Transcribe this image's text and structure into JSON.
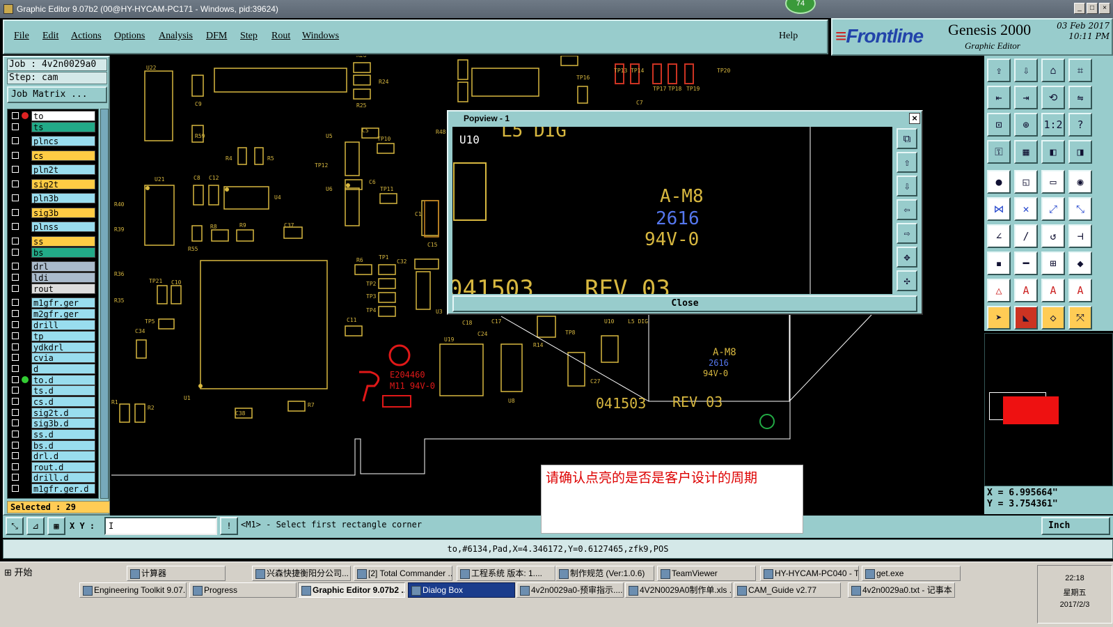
{
  "window": {
    "title": "Graphic Editor 9.07b2 (00@HY-HYCAM-PC171 - Windows, pid:39624)",
    "badge": "74"
  },
  "menu": [
    "File",
    "Edit",
    "Actions",
    "Options",
    "Analysis",
    "DFM",
    "Step",
    "Rout",
    "Windows"
  ],
  "help_label": "Help",
  "brand": {
    "logo": "Frontline",
    "product": "Genesis 2000",
    "subtitle": "Graphic Editor",
    "date": "03 Feb 2017",
    "time": "10:11 PM"
  },
  "job": {
    "job_line": "Job : 4v2n0029a0",
    "step_line": "Step: cam",
    "matrix_label": "Job Matrix ..."
  },
  "layers": [
    {
      "name": "to",
      "color": "#ffffff"
    },
    {
      "name": "ts",
      "color": "#22aa88"
    },
    {
      "name": "plncs",
      "color": "#99ddee"
    },
    {
      "name": "cs",
      "color": "#ffcc44"
    },
    {
      "name": "pln2t",
      "color": "#99ddee"
    },
    {
      "name": "sig2t",
      "color": "#ffcc44"
    },
    {
      "name": "pln3b",
      "color": "#99ddee"
    },
    {
      "name": "sig3b",
      "color": "#ffcc44"
    },
    {
      "name": "plnss",
      "color": "#99ddee"
    },
    {
      "name": "ss",
      "color": "#ffcc44"
    },
    {
      "name": "bs",
      "color": "#22aa88"
    },
    {
      "name": "drl",
      "color": "#aabbcc"
    },
    {
      "name": "ldi",
      "color": "#aabbcc"
    },
    {
      "name": "rout",
      "color": "#dddddd"
    },
    {
      "name": "m1gfr.ger",
      "color": "#99ddee"
    },
    {
      "name": "m2gfr.ger",
      "color": "#99ddee"
    },
    {
      "name": "drill",
      "color": "#99ddee"
    },
    {
      "name": "tp",
      "color": "#99ddee"
    },
    {
      "name": "ydkdrl",
      "color": "#99ddee"
    },
    {
      "name": "cvia",
      "color": "#99ddee"
    },
    {
      "name": "d",
      "color": "#99ddee"
    },
    {
      "name": "to.d",
      "color": "#99ddee"
    },
    {
      "name": "ts.d",
      "color": "#99ddee"
    },
    {
      "name": "cs.d",
      "color": "#99ddee"
    },
    {
      "name": "sig2t.d",
      "color": "#99ddee"
    },
    {
      "name": "sig3b.d",
      "color": "#99ddee"
    },
    {
      "name": "ss.d",
      "color": "#99ddee"
    },
    {
      "name": "bs.d",
      "color": "#99ddee"
    },
    {
      "name": "drl.d",
      "color": "#99ddee"
    },
    {
      "name": "rout.d",
      "color": "#99ddee"
    },
    {
      "name": "drill.d",
      "color": "#99ddee"
    },
    {
      "name": "m1gfr.ger.d",
      "color": "#99ddee"
    }
  ],
  "selected": "Selected : 29",
  "coords": {
    "x": "X =  6.995664\"",
    "y": "Y =  3.754361\""
  },
  "command": {
    "xy_label": "X Y :",
    "xy_value": "I",
    "message": "<M1> - Select first rectangle corner",
    "units": "Inch"
  },
  "status": "to,#6134,Pad,X=4.346172,Y=0.6127465,zfk9,POS",
  "popview": {
    "title": "Popview - 1",
    "close_label": "Close",
    "texts": {
      "u10": "U10",
      "mark": "A-M8",
      "num": "2616",
      "rating": "94V-0",
      "ref": "041503",
      "rev": "REV 03",
      "top": "L5  DIG"
    }
  },
  "board": {
    "labels": [
      "U22",
      "C9",
      "R59",
      "U21",
      "C8",
      "C12",
      "R4",
      "R5",
      "U4",
      "R8",
      "R9",
      "C37",
      "R40",
      "R39",
      "R55",
      "R36",
      "R35",
      "TP21",
      "C10",
      "TP5",
      "C34",
      "U1",
      "R1",
      "R2",
      "C38",
      "R7",
      "U5",
      "C5",
      "TP10",
      "TP12",
      "U6",
      "C6",
      "TP11",
      "C1",
      "R6",
      "TP1",
      "C32",
      "TP2",
      "TP3",
      "TP4",
      "C11",
      "U3",
      "C15",
      "R48",
      "R24",
      "R25",
      "R26",
      "TP16",
      "TP13",
      "TP14",
      "TP17",
      "TP18",
      "TP19",
      "TP20",
      "C7",
      "C18",
      "C17",
      "C24",
      "U19",
      "R14",
      "TP8",
      "U8",
      "C27",
      "U10",
      "L5 DIG"
    ],
    "ul_mark": "E204460",
    "ul_text": "M11 94V-0",
    "big_mark": "A-M8",
    "big_num": "2616",
    "big_rating": "94V-0",
    "ref": "041503",
    "rev": "REV 03"
  },
  "annotation": "请确认点亮的是否是客户设计的周期",
  "taskbar": {
    "start": "开始",
    "row1": [
      "计算器",
      "兴森快捷衡阳分公司...",
      "[2] Total Commander ...",
      "工程系统  版本: 1....",
      "制作规范 (Ver:1.0.6)",
      "TeamViewer",
      "HY-HYCAM-PC040 - T...",
      "get.exe"
    ],
    "row2": [
      "Engineering Toolkit 9.07...",
      "Progress",
      "Graphic Editor 9.07b2 ...",
      "Dialog Box",
      "4v2n0029a0-预审指示....",
      "4V2N0029A0制作单.xls ...",
      "CAM_Guide v2.77",
      "4v2n0029a0.txt - 记事本"
    ],
    "clock": "22:18",
    "weekday": "星期五",
    "date": "2017/2/3"
  }
}
